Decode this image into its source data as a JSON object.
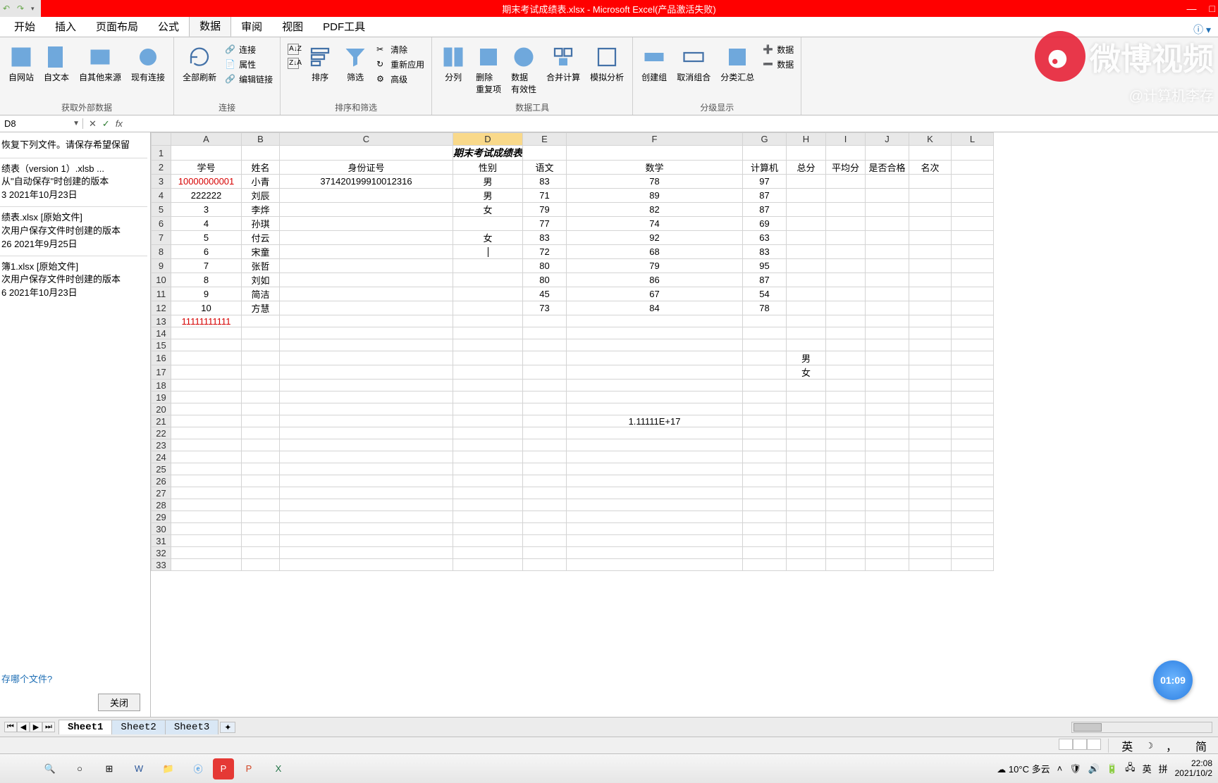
{
  "titlebar": {
    "filename": "期末考试成绩表.xlsx",
    "app": "Microsoft Excel(产品激活失败)"
  },
  "winbtns": {
    "min": "—",
    "max": "□",
    "close": ""
  },
  "tabs": [
    "开始",
    "插入",
    "页面布局",
    "公式",
    "数据",
    "审阅",
    "视图",
    "PDF工具"
  ],
  "active_tab_index": 4,
  "ribbon": {
    "g1": {
      "label": "获取外部数据",
      "btns": [
        "自网站",
        "自文本",
        "自其他来源",
        "现有连接"
      ]
    },
    "g2": {
      "label": "连接",
      "big": "全部刷新",
      "small": [
        "连接",
        "属性",
        "编辑链接"
      ]
    },
    "g3": {
      "label": "排序和筛选",
      "sort": "排序",
      "filter": "筛选",
      "small": [
        "清除",
        "重新应用",
        "高级"
      ]
    },
    "g4": {
      "label": "数据工具",
      "btns": [
        "分列",
        "删除\n重复项",
        "数据\n有效性",
        "合并计算",
        "模拟分析"
      ]
    },
    "g5": {
      "label": "分级显示",
      "btns": [
        "创建组",
        "取消组合",
        "分类汇总"
      ],
      "small": [
        "数据",
        "数据"
      ]
    }
  },
  "namebox": "D8",
  "fbar_btns": {
    "cancel": "✕",
    "enter": "✓",
    "fx": "fx"
  },
  "recovery": {
    "msg": "恢复下列文件。请保存希望保留",
    "items": [
      {
        "l1": "绩表（version 1）.xlsb  ...",
        "l2": "从\"自动保存\"时创建的版本",
        "l3": "3 2021年10月23日"
      },
      {
        "l1": "绩表.xlsx  [原始文件]",
        "l2": "次用户保存文件时创建的版本",
        "l3": "26 2021年9月25日"
      },
      {
        "l1": "簿1.xlsx  [原始文件]",
        "l2": "次用户保存文件时创建的版本",
        "l3": "6 2021年10月23日"
      }
    ],
    "ask": "存哪个文件?",
    "close": "关闭"
  },
  "sheet": {
    "title_merged": "期末考试成绩表",
    "columns": [
      "A",
      "B",
      "C",
      "D",
      "E",
      "F",
      "G",
      "H",
      "I",
      "J",
      "K",
      "L"
    ],
    "headers_row": [
      "学号",
      "姓名",
      "身份证号",
      "性别",
      "语文",
      "数学",
      "计算机",
      "总分",
      "平均分",
      "是否合格",
      "名次"
    ],
    "rows": [
      {
        "A": "10000000001",
        "A_red": true,
        "B": "小青",
        "C": "371420199910012316",
        "D": "男",
        "E": "83",
        "F": "78",
        "G": "97"
      },
      {
        "A": "222222",
        "B": "刘辰",
        "D": "男",
        "E": "71",
        "F": "89",
        "G": "87"
      },
      {
        "A": "3",
        "B": "李烨",
        "D": "女",
        "E": "79",
        "F": "82",
        "G": "87"
      },
      {
        "A": "4",
        "B": "孙琪",
        "E": "77",
        "F": "74",
        "G": "69"
      },
      {
        "A": "5",
        "B": "付云",
        "D": "女",
        "E": "83",
        "F": "92",
        "G": "63"
      },
      {
        "A": "6",
        "B": "宋童",
        "D": "",
        "D_edit": true,
        "E": "72",
        "F": "68",
        "G": "83"
      },
      {
        "A": "7",
        "B": "张哲",
        "E": "80",
        "F": "79",
        "G": "95"
      },
      {
        "A": "8",
        "B": "刘如",
        "E": "80",
        "F": "86",
        "G": "87"
      },
      {
        "A": "9",
        "B": "简洁",
        "E": "45",
        "F": "67",
        "G": "54"
      },
      {
        "A": "10",
        "B": "方慧",
        "E": "73",
        "F": "84",
        "G": "78"
      },
      {
        "A": "11111111111",
        "A_red": true
      }
    ],
    "extra": {
      "H16": "男",
      "H17": "女",
      "F21": "1.11111E+17"
    },
    "active_cell": "D8",
    "active_row": 8,
    "active_col": "D",
    "row_count": 33
  },
  "sheet_tabs": [
    "Sheet1",
    "Sheet2",
    "Sheet3"
  ],
  "active_sheet": 0,
  "statusbar": {
    "ime1": "英",
    "ime2": "简",
    "sep": "，"
  },
  "taskbar": {
    "weather": "10°C 多云",
    "ime_badge": "英",
    "ime_mode": "拼",
    "time": "22:08",
    "date": "2021/10/2"
  },
  "watermark": {
    "text": "微博视频",
    "sub": "@计算机李存"
  },
  "pill": "01:09"
}
